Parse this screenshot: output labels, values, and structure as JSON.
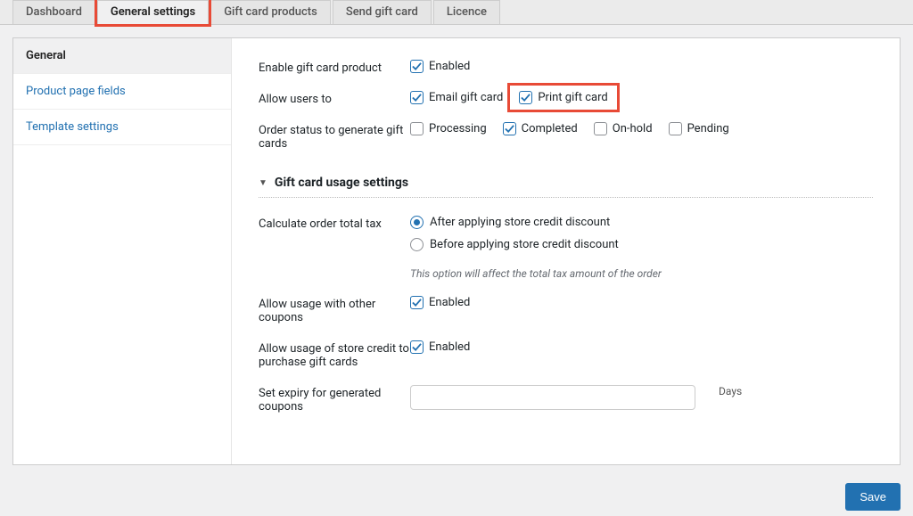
{
  "tabs": [
    {
      "label": "Dashboard"
    },
    {
      "label": "General settings"
    },
    {
      "label": "Gift card products"
    },
    {
      "label": "Send gift card"
    },
    {
      "label": "Licence"
    }
  ],
  "sidebar": {
    "items": [
      {
        "label": "General"
      },
      {
        "label": "Product page fields"
      },
      {
        "label": "Template settings"
      }
    ]
  },
  "settings": {
    "enable_product": {
      "label": "Enable gift card product",
      "enabled_label": "Enabled"
    },
    "allow_users": {
      "label": "Allow users to",
      "email_label": "Email gift card",
      "print_label": "Print gift card"
    },
    "order_status": {
      "label": "Order status to generate gift cards",
      "options": {
        "processing": "Processing",
        "completed": "Completed",
        "onhold": "On-hold",
        "pending": "Pending"
      }
    }
  },
  "usage_section": {
    "title": "Gift card usage settings",
    "calc_tax": {
      "label": "Calculate order total tax",
      "after_label": "After applying store credit discount",
      "before_label": "Before applying store credit discount",
      "desc": "This option will affect the total tax amount of the order"
    },
    "other_coupons": {
      "label": "Allow usage with other coupons",
      "enabled_label": "Enabled"
    },
    "purchase_gc": {
      "label": "Allow usage of store credit to purchase gift cards",
      "enabled_label": "Enabled"
    },
    "expiry": {
      "label": "Set expiry for generated coupons",
      "unit": "Days",
      "value": ""
    }
  },
  "footer": {
    "save_label": "Save"
  }
}
